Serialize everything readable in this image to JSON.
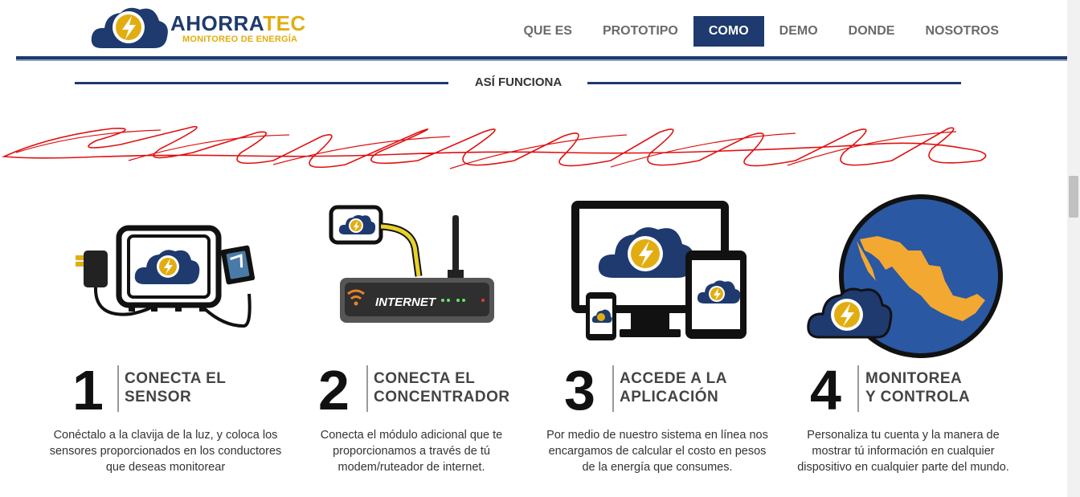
{
  "brand": {
    "name_part1": "AHORRA",
    "name_part2": "TEC",
    "subtitle": "MONITOREO DE ENERGÍA",
    "colors": {
      "navy": "#1e3a6e",
      "gold": "#e2ad10"
    }
  },
  "nav": {
    "items": [
      {
        "label": "QUE ES"
      },
      {
        "label": "PROTOTIPO"
      },
      {
        "label": "COMO",
        "active": true
      },
      {
        "label": "DEMO"
      },
      {
        "label": "DONDE"
      },
      {
        "label": "NOSOTROS"
      }
    ]
  },
  "section": {
    "title": "ASÍ FUNCIONA"
  },
  "router_label": "INTERNET",
  "steps": [
    {
      "number": "1",
      "title_line1": "CONECTA EL",
      "title_line2": "SENSOR",
      "description": "Conéctalo a la clavija de la luz, y coloca los sensores proporcionados en los conductores que deseas monitorear",
      "icon": "sensor-device-icon"
    },
    {
      "number": "2",
      "title_line1": "CONECTA EL",
      "title_line2": "CONCENTRADOR",
      "description": "Conecta el módulo adicional que te proporcionamos a través de tú modem/ruteador de internet.",
      "icon": "router-icon"
    },
    {
      "number": "3",
      "title_line1": "ACCEDE A LA",
      "title_line2": "APLICACIÓN",
      "description": "Por medio de nuestro sistema en línea nos encargamos de calcular el costo en pesos de la energía que consumes.",
      "icon": "devices-icon"
    },
    {
      "number": "4",
      "title_line1": "MONITOREA",
      "title_line2": "Y CONTROLA",
      "description": "Personaliza tu cuenta y la manera de mostrar tú información en cualquier dispositivo en cualquier parte del mundo.",
      "icon": "mexico-map-icon"
    }
  ]
}
